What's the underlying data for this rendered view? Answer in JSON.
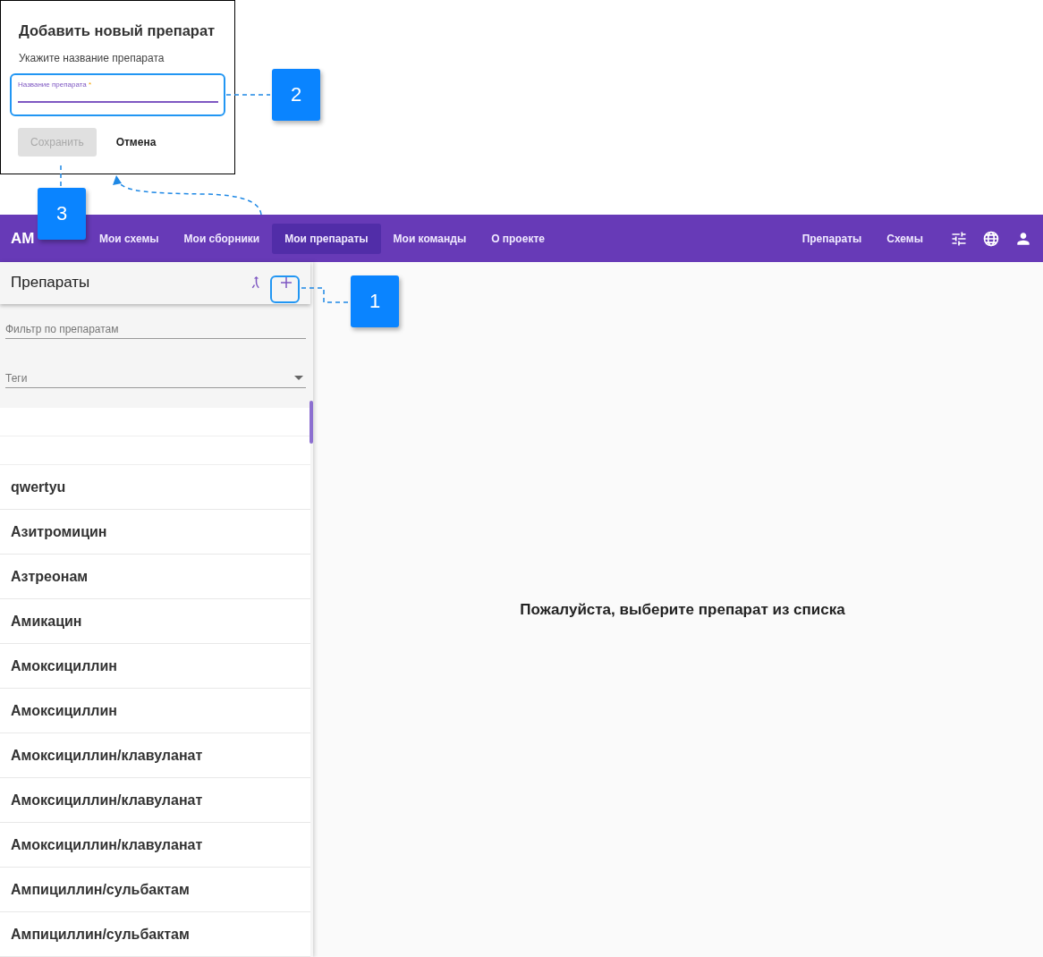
{
  "dialog": {
    "title": "Добавить новый препарат",
    "subtitle": "Укажите название препарата",
    "field": {
      "label": "Название препарата",
      "required_mark": "*"
    },
    "buttons": [
      {
        "label": "Сохранить",
        "disabled": true
      },
      {
        "label": "Отмена",
        "disabled": false
      }
    ]
  },
  "callouts": [
    "1",
    "2",
    "3"
  ],
  "navbar": {
    "logo": "AM",
    "items": [
      {
        "label": "Мои схемы",
        "selected": false
      },
      {
        "label": "Мои сборники",
        "selected": false
      },
      {
        "label": "Мои препараты",
        "selected": true
      },
      {
        "label": "Мои команды",
        "selected": false
      },
      {
        "label": "О проекте",
        "selected": false
      }
    ],
    "right_links": [
      "Препараты",
      "Схемы"
    ]
  },
  "sidebar": {
    "title": "Препараты",
    "filter": {
      "placeholder": "Фильтр по препаратам"
    },
    "tags": {
      "placeholder": "Теги"
    },
    "items": [
      "qwertyu",
      "Азитромицин",
      "Азтреонам",
      "Амикацин",
      "Амоксициллин",
      "Амоксициллин",
      "Амоксициллин/клавуланат",
      "Амоксициллин/клавуланат",
      "Амоксициллин/клавуланат",
      "Ампициллин/сульбактам",
      "Ампициллин/сульбактам"
    ]
  },
  "main": {
    "message": "Пожалуйста, выберите препарат из списка"
  }
}
